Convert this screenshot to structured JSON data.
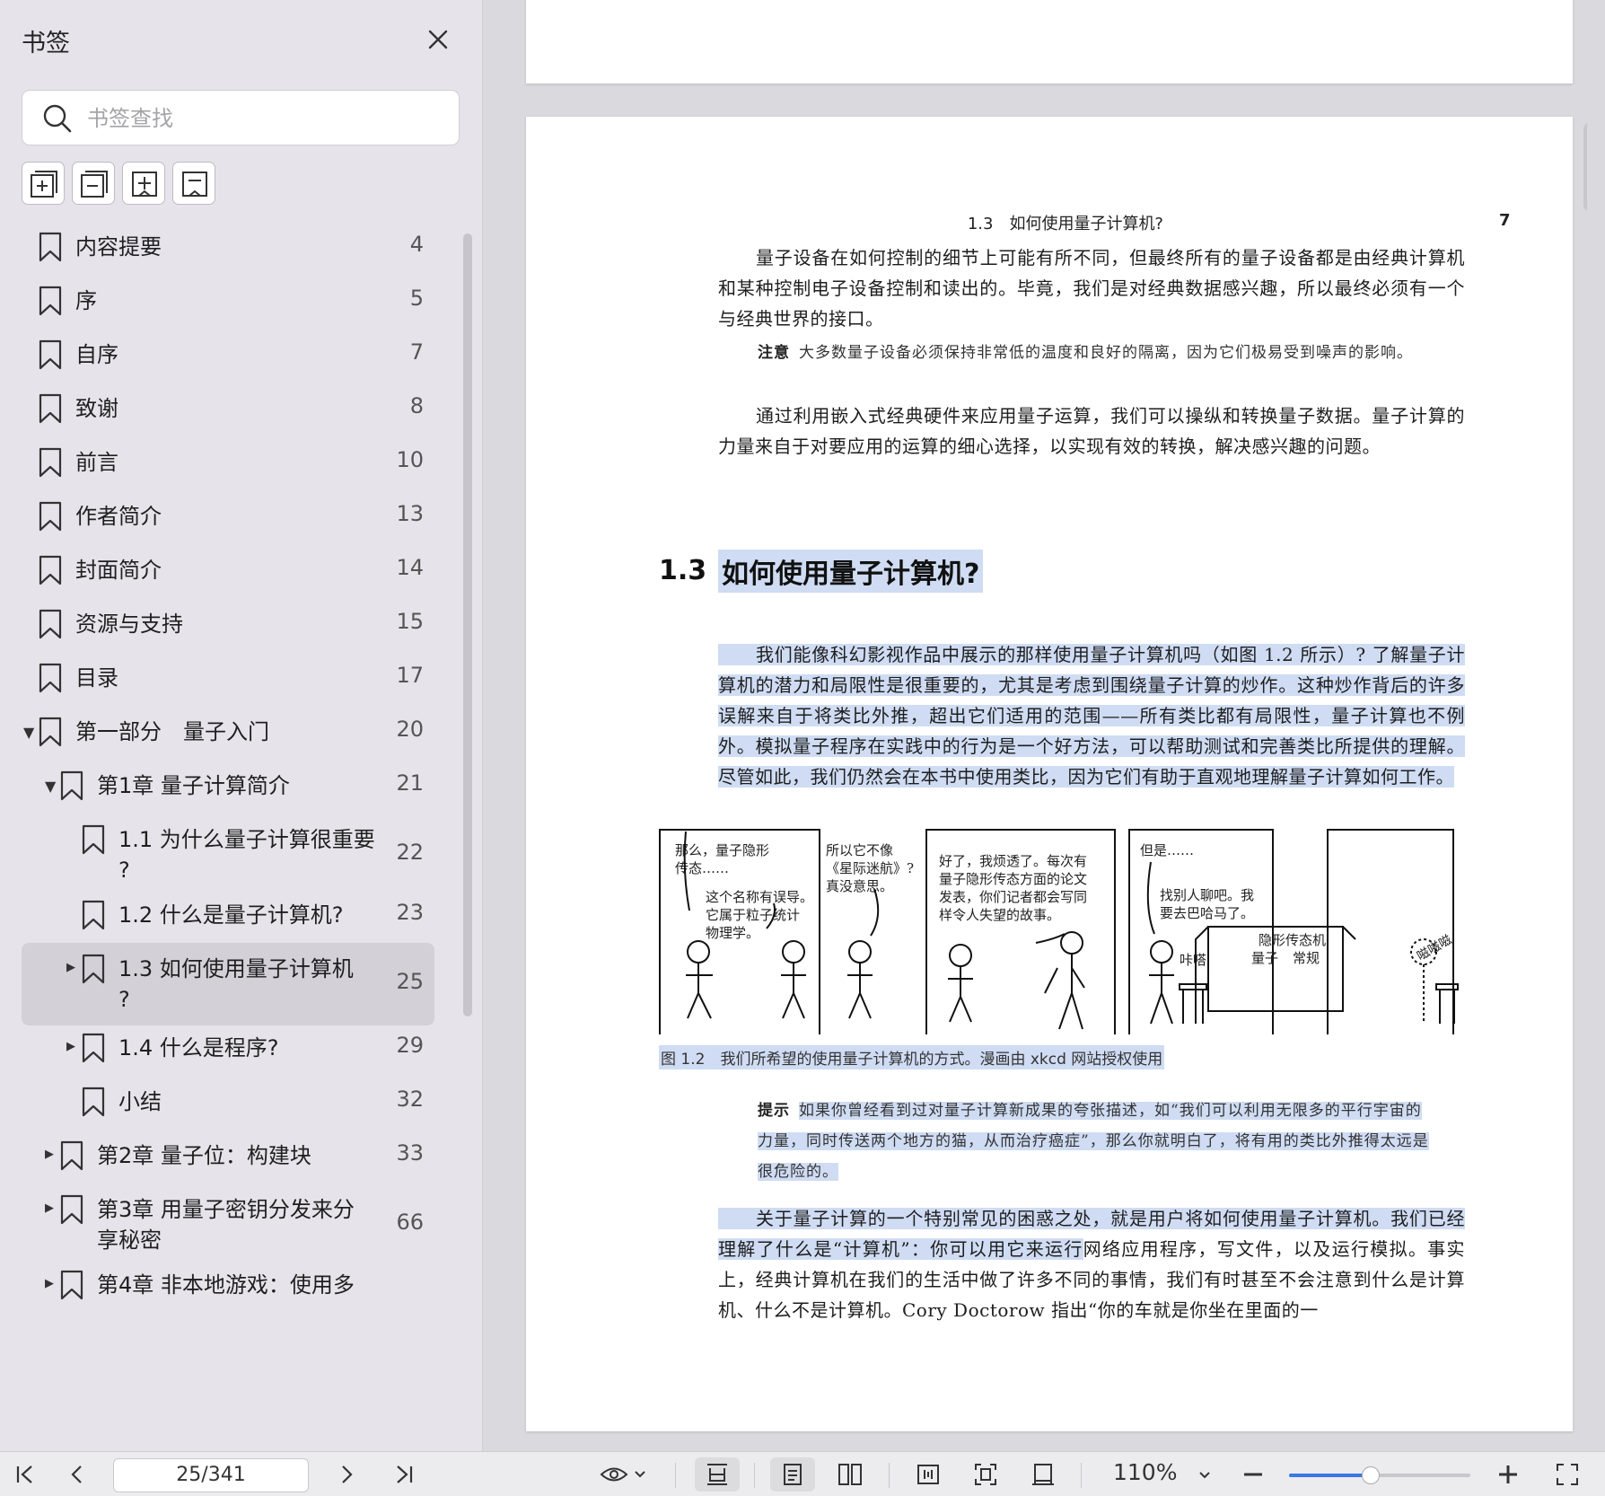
{
  "sidebar": {
    "title": "书签",
    "search_placeholder": "书签查找",
    "tools": [
      "expand-all",
      "collapse-all",
      "add-bookmark",
      "remove-bookmark"
    ],
    "items": [
      {
        "label": "内容提要",
        "page": "4"
      },
      {
        "label": "序",
        "page": "5"
      },
      {
        "label": "自序",
        "page": "7"
      },
      {
        "label": "致谢",
        "page": "8"
      },
      {
        "label": "前言",
        "page": "10"
      },
      {
        "label": "作者简介",
        "page": "13"
      },
      {
        "label": "封面简介",
        "page": "14"
      },
      {
        "label": "资源与支持",
        "page": "15"
      },
      {
        "label": "目录",
        "page": "17"
      },
      {
        "label": "第一部分　量子入门",
        "page": "20"
      },
      {
        "label": "第1章 量子计算简介",
        "page": "21"
      },
      {
        "label": "1.1 为什么量子计算很重要",
        "label2": "?",
        "page": "22"
      },
      {
        "label": "1.2 什么是量子计算机?",
        "page": "23"
      },
      {
        "label": "1.3 如何使用量子计算机",
        "label2": "?",
        "page": "25"
      },
      {
        "label": "1.4 什么是程序?",
        "page": "29"
      },
      {
        "label": "小结",
        "page": "32"
      },
      {
        "label": "第2章 量子位：构建块",
        "page": "33"
      },
      {
        "label": "第3章 用量子密钥分发来分",
        "label2": "享秘密",
        "page": "66"
      },
      {
        "label": "第4章 非本地游戏：使用多",
        "page": ""
      }
    ]
  },
  "document": {
    "running_head": "1.3　如何使用量子计算机?",
    "running_page": "7",
    "para1": "量子设备在如何控制的细节上可能有所不同，但最终所有的量子设备都是由经典计算机和某种控制电子设备控制和读出的。毕竟，我们是对经典数据感兴趣，所以最终必须有一个与经典世界的接口。",
    "note1_tag": "注意",
    "note1": "大多数量子设备必须保持非常低的温度和良好的隔离，因为它们极易受到噪声的影响。",
    "para2": "通过利用嵌入式经典硬件来应用量子运算，我们可以操纵和转换量子数据。量子计算的力量来自于对要应用的运算的细心选择，以实现有效的转换，解决感兴趣的问题。",
    "section_num": "1.3",
    "section_title": "如何使用量子计算机?",
    "para3": "我们能像科幻影视作品中展示的那样使用量子计算机吗（如图 1.2 所示）? 了解量子计算机的潜力和局限性是很重要的，尤其是考虑到围绕量子计算的炒作。这种炒作背后的许多误解来自于将类比外推，超出它们适用的范围——所有类比都有局限性，量子计算也不例外。模拟量子程序在实践中的行为是一个好方法，可以帮助测试和完善类比所提供的理解。尽管如此，我们仍然会在本书中使用类比，因为它们有助于直观地理解量子计算如何工作。",
    "comic": {
      "p1a": "那么，量子隐形",
      "p1b": "传态……",
      "p1c": "这个名称有误导。",
      "p1d": "它属于粒子统计",
      "p1e": "物理学。",
      "p2a": "所以它不像",
      "p2b": "《星际迷航》?",
      "p2c": "真没意思。",
      "p3a": "好了，我烦透了。每次有",
      "p3b": "量子隐形传态方面的论文",
      "p3c": "发表，你们记者都会写同",
      "p3d": "样令人失望的故事。",
      "p4a": "但是……",
      "p4b": "找别人聊吧。我",
      "p4c": "要去巴哈马了。",
      "p4d": "咔嗒",
      "p4e": "隐形传态机",
      "p4f": "量子",
      "p4g": "常规",
      "p5a": "嗞嗞嗞"
    },
    "caption": "图 1.2　我们所希望的使用量子计算机的方式。漫画由 xkcd 网站授权使用",
    "tip_tag": "提示",
    "tip": "如果你曾经看到过对量子计算新成果的夸张描述，如“我们可以利用无限多的平行宇宙的力量，同时传送两个地方的猫，从而治疗癌症”，那么你就明白了，将有用的类比外推得太远是很危险的。",
    "para4_hl": "关于量子计算的一个特别常见的困惑之处，就是用户将如何使用量子计算机。我们已经理解了什么是“计算机”：你可以用它来运行",
    "para4_rest": "网络应用程序，写文件，以及运行模拟。事实上，经典计算机在我们的生活中做了许多不同的事情，我们有时甚至不会注意到什么是计算机、什么不是计算机。Cory Doctorow 指出“你的车就是你坐在里面的一"
  },
  "toolbar": {
    "page_indicator": "25/341",
    "zoom": "110%",
    "zoom_fraction": 0.45,
    "accent": "#3a78e6",
    "highlight": "#cfdcf3"
  }
}
